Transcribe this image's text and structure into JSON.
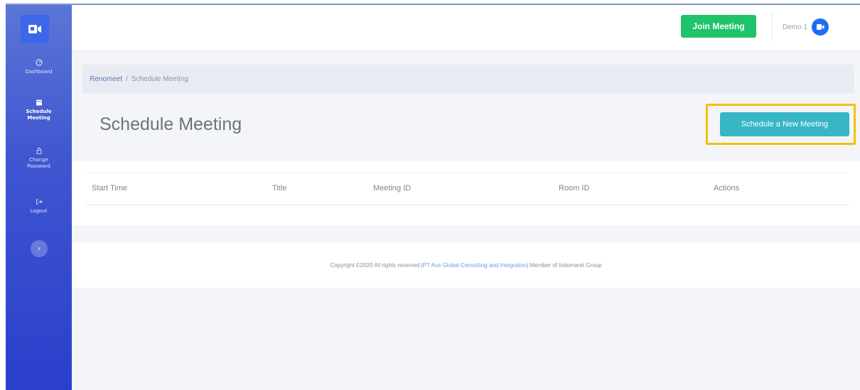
{
  "sidebar": {
    "items": [
      {
        "label": "Dashboard",
        "icon": "dashboard-icon",
        "active": false
      },
      {
        "label": "Schedule Meeting",
        "icon": "calendar-icon",
        "active": true
      },
      {
        "label": "Change Password",
        "icon": "lock-icon",
        "active": false
      },
      {
        "label": "Logout",
        "icon": "logout-icon",
        "active": false
      }
    ]
  },
  "topbar": {
    "join_label": "Join Meeting",
    "user_name": "Demo 1"
  },
  "breadcrumb": {
    "root": "Renomeet",
    "separator": "/",
    "current": "Schedule Meeting"
  },
  "page": {
    "title": "Schedule Meeting",
    "new_meeting_label": "Schedule a New Meeting"
  },
  "table": {
    "columns": [
      "Start Time",
      "Title",
      "Meeting ID",
      "Room ID",
      "Actions"
    ]
  },
  "footer": {
    "prefix": "Copyright ©2020 All rights reserved |",
    "company": " PT Ace Global Consulting and Integration ",
    "suffix": "| Member of Indomaret Group"
  },
  "colors": {
    "sidebar_gradient_top": "#5b76d6",
    "sidebar_gradient_bottom": "#2a3fcc",
    "join_button": "#1fc36a",
    "schedule_button": "#37b6c6",
    "highlight": "#f5c002",
    "avatar": "#1c6ff0"
  }
}
